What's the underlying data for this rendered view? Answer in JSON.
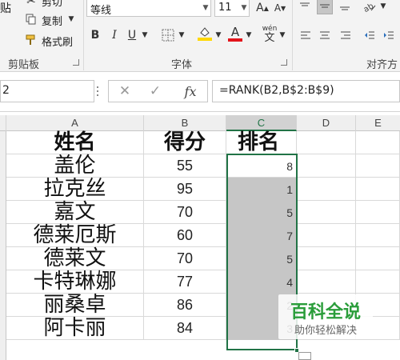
{
  "ribbon": {
    "clipboard": {
      "cut_label": "剪切",
      "copy_label": "复制",
      "format_painter_label": "格式刷",
      "group_label": "剪贴板",
      "paste_label": "贴"
    },
    "font": {
      "font_name": "等线",
      "font_size": "11",
      "bold_label": "B",
      "italic_label": "I",
      "underline_label": "U",
      "phonetic_label": "文",
      "font_color_label": "A",
      "group_label": "字体",
      "fill_color": "#ffd800",
      "font_color": "#e3141b"
    },
    "alignment": {
      "group_label": "对齐方"
    }
  },
  "formula_bar": {
    "name_box_value": "2",
    "fx_label": "fx",
    "formula": "=RANK(B2,B$2:B$9)"
  },
  "columns": [
    "A",
    "B",
    "C",
    "D",
    "E"
  ],
  "sheet": {
    "header": {
      "name": "姓名",
      "score": "得分",
      "rank": "排名"
    },
    "rows": [
      {
        "name": "盖伦",
        "score": "55",
        "rank": "8"
      },
      {
        "name": "拉克丝",
        "score": "95",
        "rank": "1"
      },
      {
        "name": "嘉文",
        "score": "70",
        "rank": "5"
      },
      {
        "name": "德莱厄斯",
        "score": "60",
        "rank": "7"
      },
      {
        "name": "德莱文",
        "score": "70",
        "rank": "5"
      },
      {
        "name": "卡特琳娜",
        "score": "77",
        "rank": "4"
      },
      {
        "name": "丽桑卓",
        "score": "86",
        "rank": "2"
      },
      {
        "name": "阿卡丽",
        "score": "84",
        "rank": "3"
      }
    ]
  },
  "watermark": {
    "title": "百科全说",
    "subtitle": "助你轻松解决"
  },
  "colors": {
    "excel_green": "#217346",
    "selected_cell_bg": "#c6c6c6",
    "watermark_green": "#2a9d3a"
  }
}
